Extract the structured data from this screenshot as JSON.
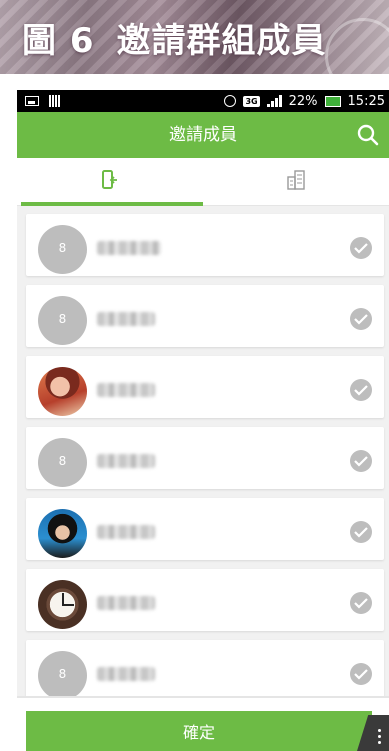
{
  "banner": {
    "figure_label": "圖 6",
    "title": "邀請群組成員"
  },
  "status_bar": {
    "battery_percent": "22%",
    "time": "15:25",
    "network": "3G"
  },
  "header": {
    "title": "邀請成員"
  },
  "tabs": [
    {
      "icon": "phone-contacts-icon",
      "active": true
    },
    {
      "icon": "company-building-icon",
      "active": false
    }
  ],
  "contacts": [
    {
      "avatar": "default",
      "name_width": 64,
      "checked": true
    },
    {
      "avatar": "default",
      "name_width": 58,
      "checked": true
    },
    {
      "avatar": "photo-woman1",
      "name_width": 58,
      "checked": true
    },
    {
      "avatar": "default",
      "name_width": 58,
      "checked": true
    },
    {
      "avatar": "photo-woman2",
      "name_width": 58,
      "checked": true
    },
    {
      "avatar": "photo-clock",
      "name_width": 58,
      "checked": true
    },
    {
      "avatar": "default",
      "name_width": 58,
      "checked": true
    }
  ],
  "footer": {
    "confirm_label": "確定"
  },
  "colors": {
    "accent": "#6dbb45",
    "check_inactive": "#bdbdbd",
    "list_bg": "#f1f1f1"
  }
}
